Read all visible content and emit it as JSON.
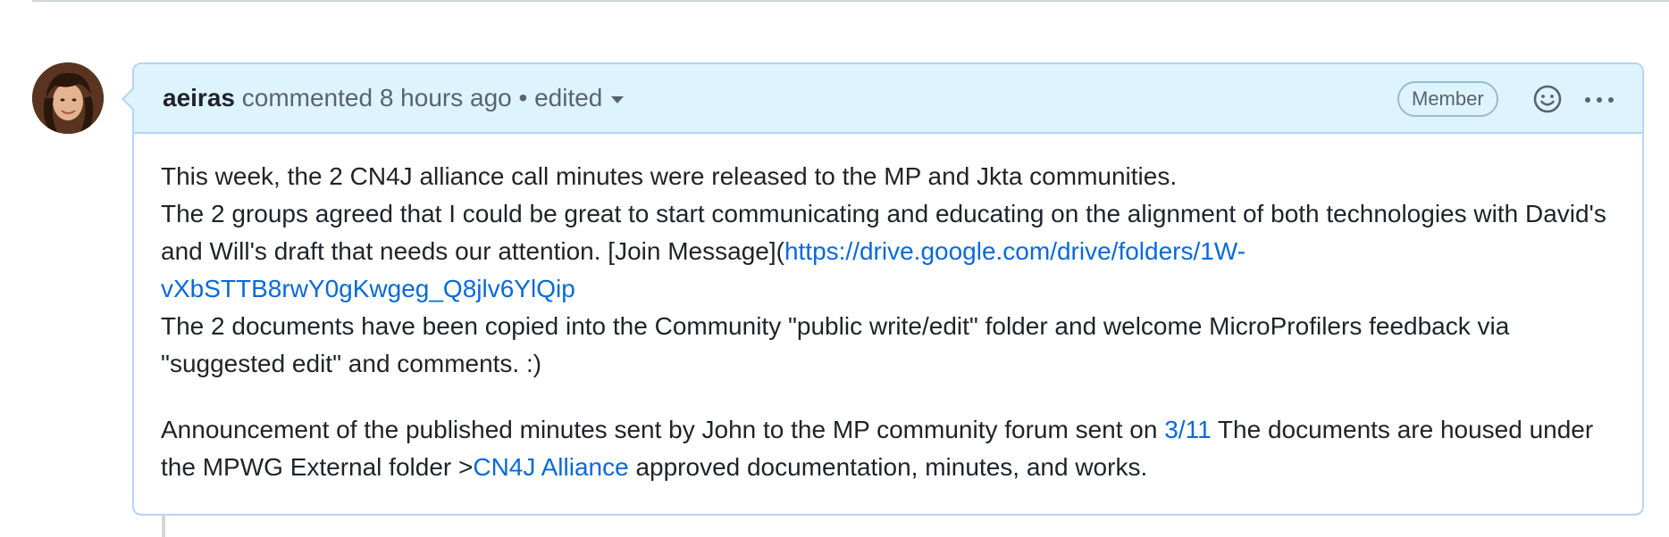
{
  "comment": {
    "author": "aeiras",
    "action": "commented",
    "timestamp": "8 hours ago",
    "separator": "•",
    "edited_label": "edited",
    "badge": "Member",
    "icons": {
      "reaction": "smiley-icon",
      "menu": "kebab-horizontal-icon",
      "edited_dropdown": "caret-down-icon"
    },
    "paragraph1": {
      "line1": "This week, the 2 CN4J alliance call minutes were released to the MP and Jkta communities.",
      "line2_text": "The 2 groups agreed that I could be great to start communicating and educating on the alignment of both technologies with David's and Will's draft that needs our attention. [Join Message](",
      "line2_link": "https://drive.google.com/drive/folders/1W-vXbSTTB8rwY0gKwgeg_Q8jlv6YlQip",
      "line3": "The 2 documents have been copied into the Community \"public write/edit\" folder and welcome MicroProfilers feedback via \"suggested edit\" and comments. :)"
    },
    "paragraph2": {
      "text_before": "Announcement of the published minutes sent by John to the MP community forum sent on ",
      "link_date": "3/11",
      "text_middle": " The documents are housed under the MPWG External folder >",
      "link_folder": "CN4J Alliance",
      "text_after": " approved documentation, minutes, and works."
    }
  },
  "colors": {
    "link": "#0969da",
    "header_bg": "#ddf4ff",
    "border": "#b6d4f5"
  }
}
